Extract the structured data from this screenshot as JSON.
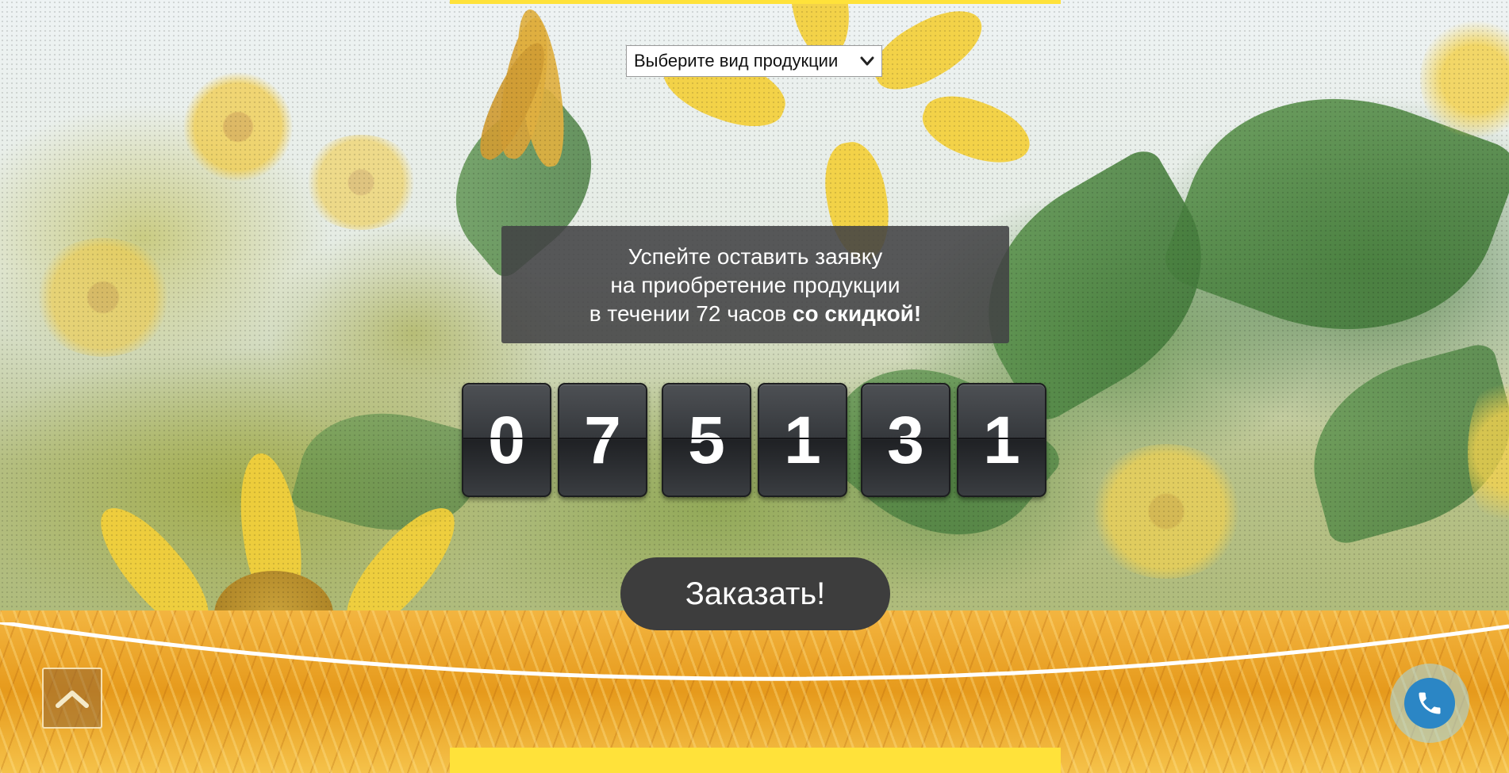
{
  "product_select": {
    "selected": "Выберите вид продукции",
    "icon": "chevron-down-icon"
  },
  "promo": {
    "line1": "Успейте оставить заявку",
    "line2": "на приобретение продукции",
    "line3_prefix": "в течении 72 часов ",
    "line3_bold": "со скидкой!"
  },
  "countdown": {
    "digits": [
      "0",
      "7",
      "5",
      "1",
      "3",
      "1"
    ]
  },
  "order_button": {
    "label": "Заказать!"
  },
  "scroll_top": {
    "icon": "chevron-up-icon"
  },
  "callback": {
    "icon": "phone-icon"
  },
  "colors": {
    "accent_yellow": "#ffe23a",
    "panel": "#424244",
    "button": "#3d3d3d",
    "phone_blue": "#2b86c5"
  }
}
